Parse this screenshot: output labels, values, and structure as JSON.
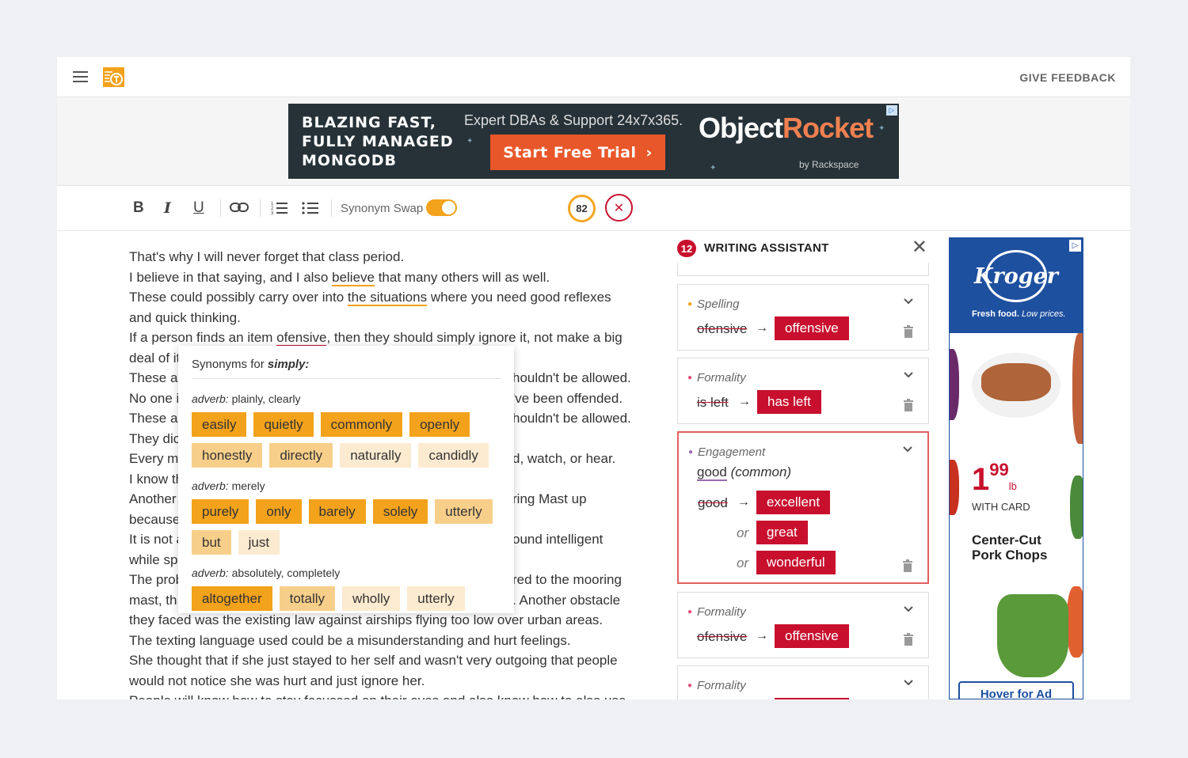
{
  "header": {
    "feedback": "GIVE FEEDBACK"
  },
  "banner_ad": {
    "headline": [
      "BLAZING FAST,",
      "FULLY MANAGED",
      "MONGODB"
    ],
    "subtitle": "Expert DBAs & Support 24x7x365.",
    "cta": "Start Free Trial",
    "brand_a": "Object",
    "brand_b": "Rocket",
    "by": "by Rackspace"
  },
  "toolbar": {
    "bold": "B",
    "italic": "I",
    "underline": "U",
    "synonym_swap_label": "Synonym Swap",
    "synonym_swap_on": true,
    "score": "82"
  },
  "editor": {
    "lines": [
      "That's why I will never forget that class period.",
      [
        "I believe in that saying, and I also ",
        "believe",
        " that many others will as well."
      ],
      [
        "These could possibly carry over into ",
        "the situations",
        " where you need good reflexes"
      ],
      "and quick thinking.",
      [
        "If a person finds an item ",
        "ofensive",
        ", then they should simply ignore it, not make a big"
      ],
      "deal of it",
      [
        "These a",
        "houldn't be allowed."
      ],
      [
        "No one i",
        "'ve been offended."
      ],
      [
        "These a",
        "houldn't be allowed."
      ],
      [
        "They dic",
        ""
      ],
      [
        "Every m",
        "d, watch, or hear."
      ],
      [
        "I know th",
        ""
      ],
      [
        "Another",
        "ring Mast up"
      ],
      [
        "because",
        ""
      ],
      [
        "It is not a",
        "ound intelligent"
      ],
      [
        "while sp",
        ""
      ],
      [
        "The prob",
        "red to the mooring"
      ],
      [
        "mast, th",
        ". Another obstacle"
      ],
      "they faced was the existing law against airships flying too low over urban areas.",
      "The texting language used could be a misunderstanding and hurt feelings.",
      "She thought that if she just stayed to her self and wasn't very outgoing that people",
      "would not notice she was hurt and just ignore her.",
      "People will know how to stay focussed on their eyes and also know how to also use"
    ]
  },
  "synonyms_popup": {
    "title_prefix": "Synonyms for ",
    "word": "simply:",
    "groups": [
      {
        "pos": "adverb:",
        "meaning": "plainly, clearly",
        "chips": [
          [
            "easily",
            1
          ],
          [
            "quietly",
            1
          ],
          [
            "commonly",
            1
          ],
          [
            "openly",
            1
          ],
          [
            "honestly",
            2
          ],
          [
            "directly",
            2
          ],
          [
            "naturally",
            3
          ],
          [
            "candidly",
            3
          ]
        ]
      },
      {
        "pos": "adverb:",
        "meaning": "merely",
        "chips": [
          [
            "purely",
            1
          ],
          [
            "only",
            1
          ],
          [
            "barely",
            1
          ],
          [
            "solely",
            1
          ],
          [
            "utterly",
            2
          ],
          [
            "but",
            2
          ],
          [
            "just",
            3
          ]
        ]
      },
      {
        "pos": "adverb:",
        "meaning": "absolutely, completely",
        "chips": [
          [
            "altogether",
            1
          ],
          [
            "totally",
            2
          ],
          [
            "wholly",
            3
          ],
          [
            "utterly",
            3
          ]
        ]
      }
    ]
  },
  "assistant": {
    "count": "12",
    "title": "WRITING ASSISTANT",
    "cards": [
      {
        "category": "Spelling",
        "dot": "#f3a21b",
        "from": "ofensive",
        "to": "offensive"
      },
      {
        "category": "Formality",
        "dot": "#e0507a",
        "from": "is left",
        "to": "has left"
      },
      {
        "category": "Engagement",
        "dot": "#9a6ab0",
        "word": "good",
        "note": "(common)",
        "from": "good",
        "options": [
          "excellent",
          "great",
          "wonderful"
        ],
        "or": "or"
      },
      {
        "category": "Formality",
        "dot": "#e0507a",
        "from": "ofensive",
        "to": "offensive"
      },
      {
        "category": "Formality",
        "dot": "#e0507a"
      }
    ]
  },
  "side_ad": {
    "brand": "Kroger",
    "tagline_a": "Fresh food.",
    "tagline_b": " Low prices.",
    "price_dollars": "1",
    "price_cents": "99",
    "price_unit": "lb",
    "with_card": "WITH CARD",
    "product_line1": "Center-Cut",
    "product_line2": "Pork Chops",
    "hover": "Hover for Ad"
  }
}
